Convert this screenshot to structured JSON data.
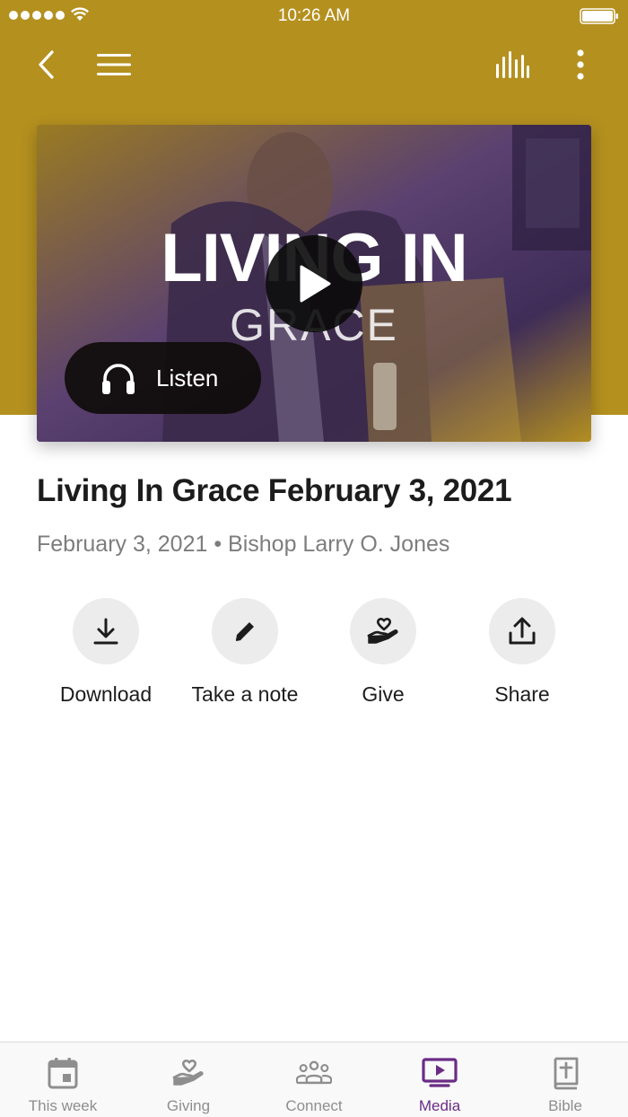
{
  "status_bar": {
    "time": "10:26 AM"
  },
  "hero": {
    "title_top": "LIVING IN",
    "title_bottom": "GRACE",
    "listen_label": "Listen"
  },
  "sermon": {
    "title": "Living In Grace February 3, 2021",
    "meta": "February 3, 2021 • Bishop Larry O. Jones"
  },
  "actions": [
    {
      "label": "Download",
      "icon": "download-icon"
    },
    {
      "label": "Take a note",
      "icon": "pencil-icon"
    },
    {
      "label": "Give",
      "icon": "heart-hand-icon"
    },
    {
      "label": "Share",
      "icon": "share-icon"
    }
  ],
  "tabs": [
    {
      "label": "This week",
      "icon": "calendar-icon"
    },
    {
      "label": "Giving",
      "icon": "heart-hand-icon"
    },
    {
      "label": "Connect",
      "icon": "people-icon"
    },
    {
      "label": "Media",
      "icon": "tv-play-icon",
      "active": true
    },
    {
      "label": "Bible",
      "icon": "bible-icon"
    }
  ],
  "colors": {
    "header": "#b4901f",
    "accent": "#6a2c86",
    "tab_inactive": "#8e8e8e"
  }
}
